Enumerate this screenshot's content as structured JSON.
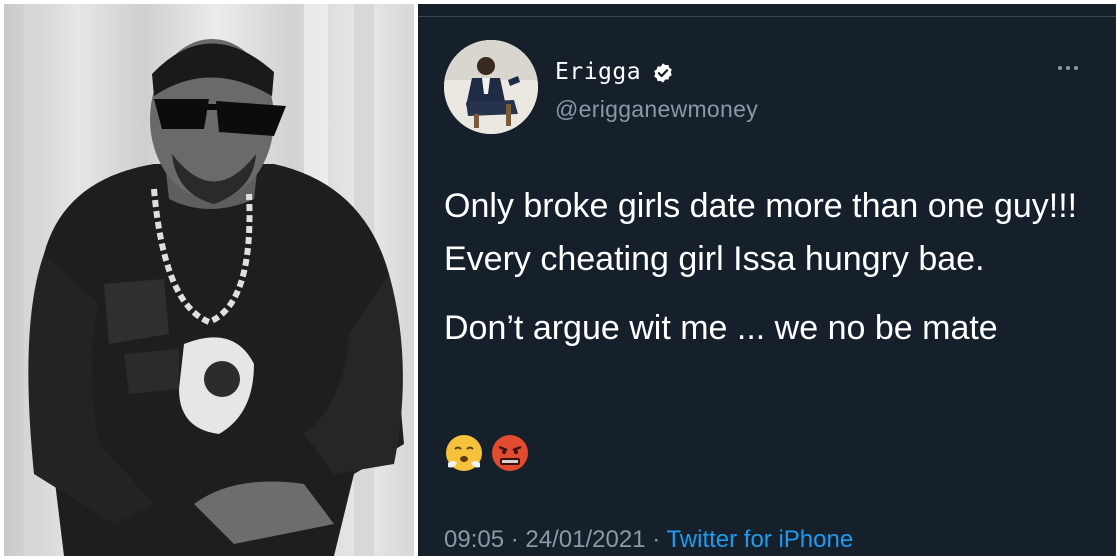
{
  "photo": {
    "icon": "person-photo"
  },
  "tweet": {
    "author_name": "Erigga",
    "handle": "@erigganewmoney",
    "verified_icon": "verified-badge-icon",
    "more_icon": "more-options-icon",
    "text_line_1": "Only broke girls date more than one guy!!! Every cheating girl Issa hungry bae.",
    "text_line_2": "Don’t argue wit me ... we no be mate",
    "emojis": [
      "face-with-steam-emoji",
      "angry-face-emoji"
    ],
    "time": "09:05",
    "separator": "·",
    "date": "24/01/2021",
    "source": "Twitter for iPhone",
    "colors": {
      "background": "#15202b",
      "link": "#1d9bf0",
      "secondary": "#8b98a5"
    }
  }
}
